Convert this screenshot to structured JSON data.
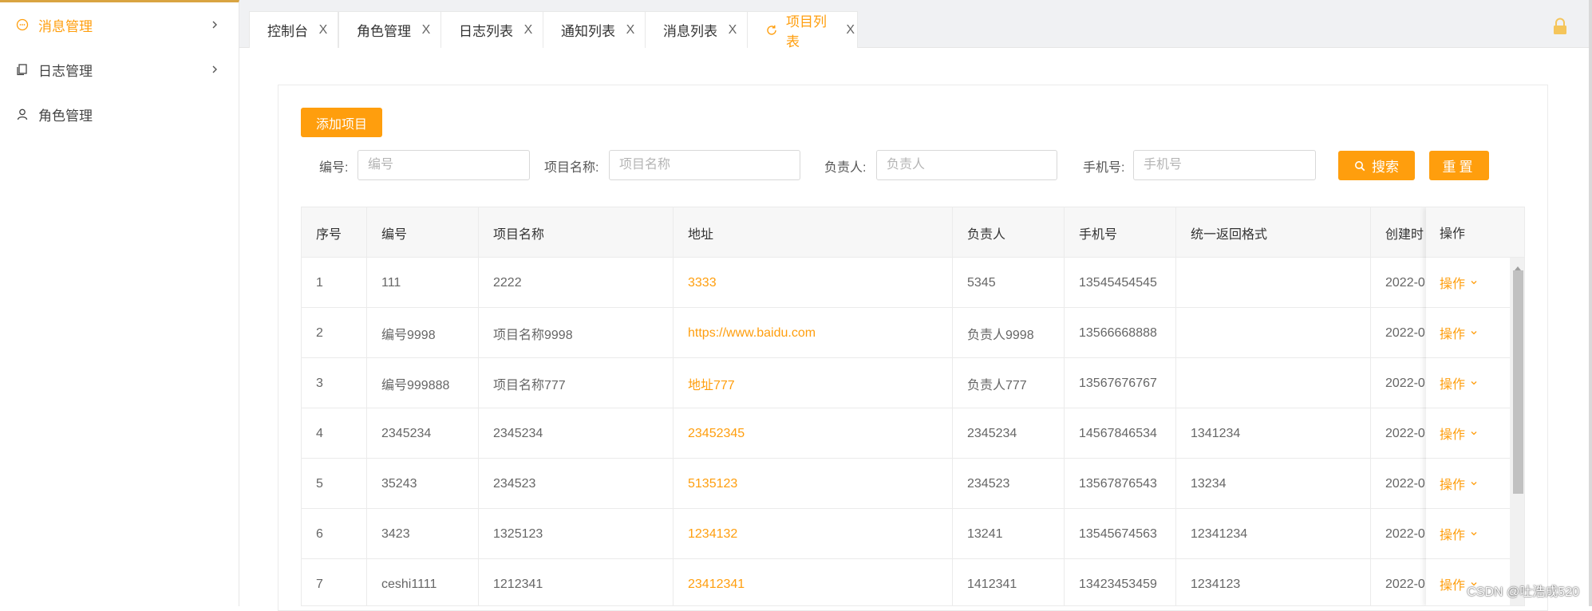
{
  "sidebar": {
    "items": [
      {
        "label": "消息管理",
        "icon": "message-icon",
        "active": true,
        "expandable": true
      },
      {
        "label": "日志管理",
        "icon": "log-icon",
        "active": false,
        "expandable": true
      },
      {
        "label": "角色管理",
        "icon": "user-icon",
        "active": false,
        "expandable": false
      }
    ]
  },
  "tabs": [
    {
      "label": "控制台",
      "close": "X"
    },
    {
      "label": "角色管理",
      "close": "X"
    },
    {
      "label": "日志列表",
      "close": "X"
    },
    {
      "label": "通知列表",
      "close": "X"
    },
    {
      "label": "消息列表",
      "close": "X"
    },
    {
      "label": "项目列表",
      "close": "X",
      "active": true
    }
  ],
  "toolbar": {
    "add_label": "添加项目",
    "search_label": "搜索",
    "reset_label": "重置"
  },
  "filters": [
    {
      "label": "编号:",
      "placeholder": "编号",
      "value": ""
    },
    {
      "label": "项目名称:",
      "placeholder": "项目名称",
      "value": ""
    },
    {
      "label": "负责人:",
      "placeholder": "负责人",
      "value": ""
    },
    {
      "label": "手机号:",
      "placeholder": "手机号",
      "value": ""
    }
  ],
  "table": {
    "headers": [
      "序号",
      "编号",
      "项目名称",
      "地址",
      "负责人",
      "手机号",
      "统一返回格式",
      "创建时"
    ],
    "op_header": "操作",
    "op_label": "操作",
    "rows": [
      [
        "1",
        "111",
        "2222",
        "3333",
        "5345",
        "13545454545",
        "",
        "2022-0"
      ],
      [
        "2",
        "编号9998",
        "项目名称9998",
        "https://www.baidu.com",
        "负责人9998",
        "13566668888",
        "",
        "2022-0"
      ],
      [
        "3",
        "编号999888",
        "项目名称777",
        "地址777",
        "负责人777",
        "13567676767",
        "",
        "2022-0"
      ],
      [
        "4",
        "2345234",
        "2345234",
        "23452345",
        "2345234",
        "14567846534",
        "1341234",
        "2022-0"
      ],
      [
        "5",
        "35243",
        "234523",
        "5135123",
        "234523",
        "13567876543",
        "13234",
        "2022-0"
      ],
      [
        "6",
        "3423",
        "1325123",
        "1234132",
        "13241",
        "13545674563",
        "12341234",
        "2022-0"
      ],
      [
        "7",
        "ceshi1111",
        "1212341",
        "23412341",
        "1412341",
        "13423453459",
        "1234123",
        "2022-0"
      ]
    ]
  },
  "watermark": "CSDN @吐浩成520",
  "colors": {
    "accent": "#ff9e0d",
    "sidebar_top": "#d9a441"
  }
}
